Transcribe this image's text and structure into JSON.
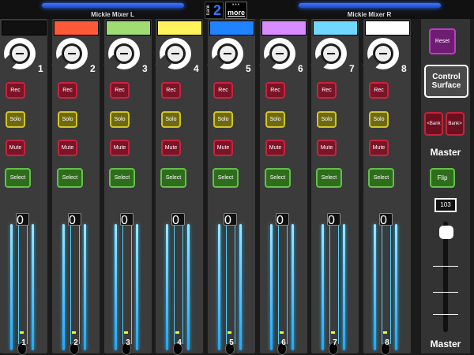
{
  "top": {
    "left_mixer": "Mickie Mixer L",
    "right_mixer": "Mickie Mixer R",
    "bank_label": "bank",
    "bank_value": "2",
    "more_label": "more",
    "more_dots": "•••"
  },
  "strips": [
    {
      "number": "1",
      "label": "1",
      "rec": "Rec",
      "solo": "Solo",
      "mute": "Mute",
      "select": "Select",
      "fader_value": "0",
      "color": "#111111"
    },
    {
      "number": "2",
      "label": "2",
      "rec": "Rec",
      "solo": "Solo",
      "mute": "Mute",
      "select": "Select",
      "fader_value": "0",
      "color": "#ff5a37"
    },
    {
      "number": "3",
      "label": "3",
      "rec": "Rec",
      "solo": "Solo",
      "mute": "Mute",
      "select": "Select",
      "fader_value": "0",
      "color": "#9fdc72"
    },
    {
      "number": "4",
      "label": "4",
      "rec": "Rec",
      "solo": "Solo",
      "mute": "Mute",
      "select": "Select",
      "fader_value": "0",
      "color": "#fff25a"
    },
    {
      "number": "5",
      "label": "5",
      "rec": "Rec",
      "solo": "Solo",
      "mute": "Mute",
      "select": "Select",
      "fader_value": "0",
      "color": "#1f82ff"
    },
    {
      "number": "6",
      "label": "6",
      "rec": "Rec",
      "solo": "Solo",
      "mute": "Mute",
      "select": "Select",
      "fader_value": "0",
      "color": "#d98cff"
    },
    {
      "number": "7",
      "label": "7",
      "rec": "Rec",
      "solo": "Solo",
      "mute": "Mute",
      "select": "Select",
      "fader_value": "0",
      "color": "#70d8ff"
    },
    {
      "number": "8",
      "label": "8",
      "rec": "Rec",
      "solo": "Solo",
      "mute": "Mute",
      "select": "Select",
      "fader_value": "0",
      "color": "#ffffff"
    }
  ],
  "master": {
    "reset": "Reset",
    "control_line1": "Control",
    "control_line2": "Surface",
    "bank_left": "<Bank",
    "bank_right": "Bank>",
    "title": "Master",
    "flip": "Flip",
    "fader_value": "103",
    "footer": "Master"
  }
}
